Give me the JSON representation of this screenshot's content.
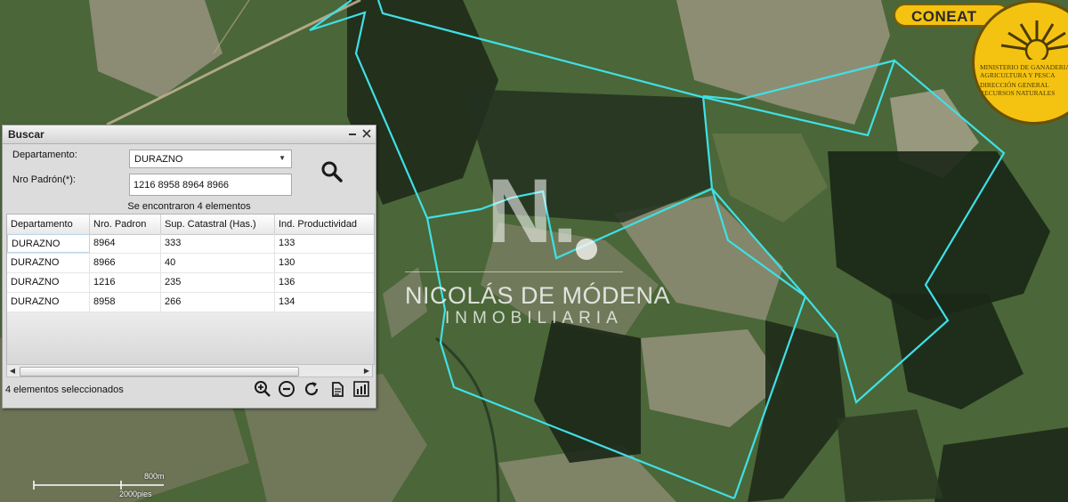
{
  "app": {
    "brand": "CONEAT"
  },
  "seal": {
    "lines": [
      "MINISTERIO DE GANADERIA",
      "AGRICULTURA Y PESCA",
      "DIRECCIÓN GENERAL",
      "RECURSOS NATURALES"
    ]
  },
  "watermark": {
    "logo_letter": "N.",
    "name": "NICOLÁS DE MÓDENA",
    "subtitle": "INMOBILIARIA"
  },
  "search_panel": {
    "title": "Buscar",
    "minimize_icon": "minimize-icon",
    "close_icon": "close-icon",
    "departamento_label": "Departamento:",
    "departamento_value": "DURAZNO",
    "padron_label": "Nro Padrón(*):",
    "padron_value": "1216 8958 8964 8966",
    "search_icon": "magnifier-icon",
    "result_message": "Se encontraron 4 elementos",
    "columns": [
      "Departamento",
      "Nro. Padron",
      "Sup. Catastral (Has.)",
      "Ind. Productividad"
    ],
    "rows": [
      [
        "DURAZNO",
        "8964",
        "333",
        "133"
      ],
      [
        "DURAZNO",
        "8966",
        "40",
        "130"
      ],
      [
        "DURAZNO",
        "1216",
        "235",
        "136"
      ],
      [
        "DURAZNO",
        "8958",
        "266",
        "134"
      ]
    ],
    "status": "4 elementos seleccionados",
    "tools": [
      "zoom-in-icon",
      "zoom-out-icon",
      "refresh-icon",
      "report-icon",
      "chart-icon"
    ]
  },
  "scale_bar": {
    "metric": "800m",
    "imperial": "2000pies"
  },
  "colors": {
    "parcel_outline": "#3fe0e6",
    "seal_yellow": "#f4c311",
    "panel_bg": "#dcdcdc"
  }
}
